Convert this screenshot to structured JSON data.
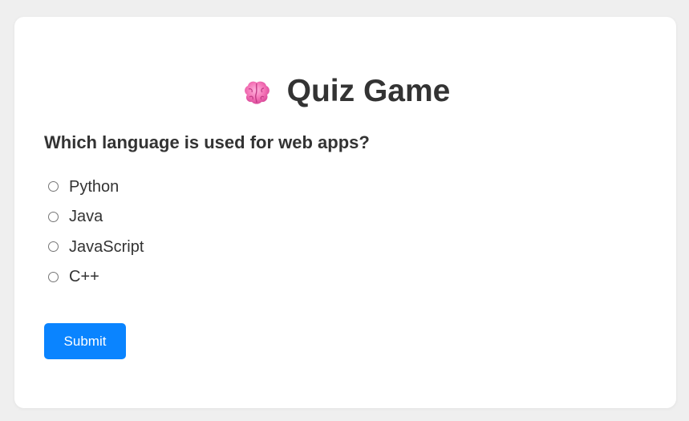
{
  "quiz": {
    "title": "Quiz Game",
    "title_icon": "brain-icon",
    "question": "Which language is used for web apps?",
    "options": [
      {
        "label": "Python",
        "selected": false
      },
      {
        "label": "Java",
        "selected": false
      },
      {
        "label": "JavaScript",
        "selected": false
      },
      {
        "label": "C++",
        "selected": false
      }
    ],
    "submit_label": "Submit"
  },
  "colors": {
    "background": "#efefef",
    "card": "#ffffff",
    "text": "#333333",
    "accent": "#0a84ff",
    "brain": "#f472b6"
  }
}
